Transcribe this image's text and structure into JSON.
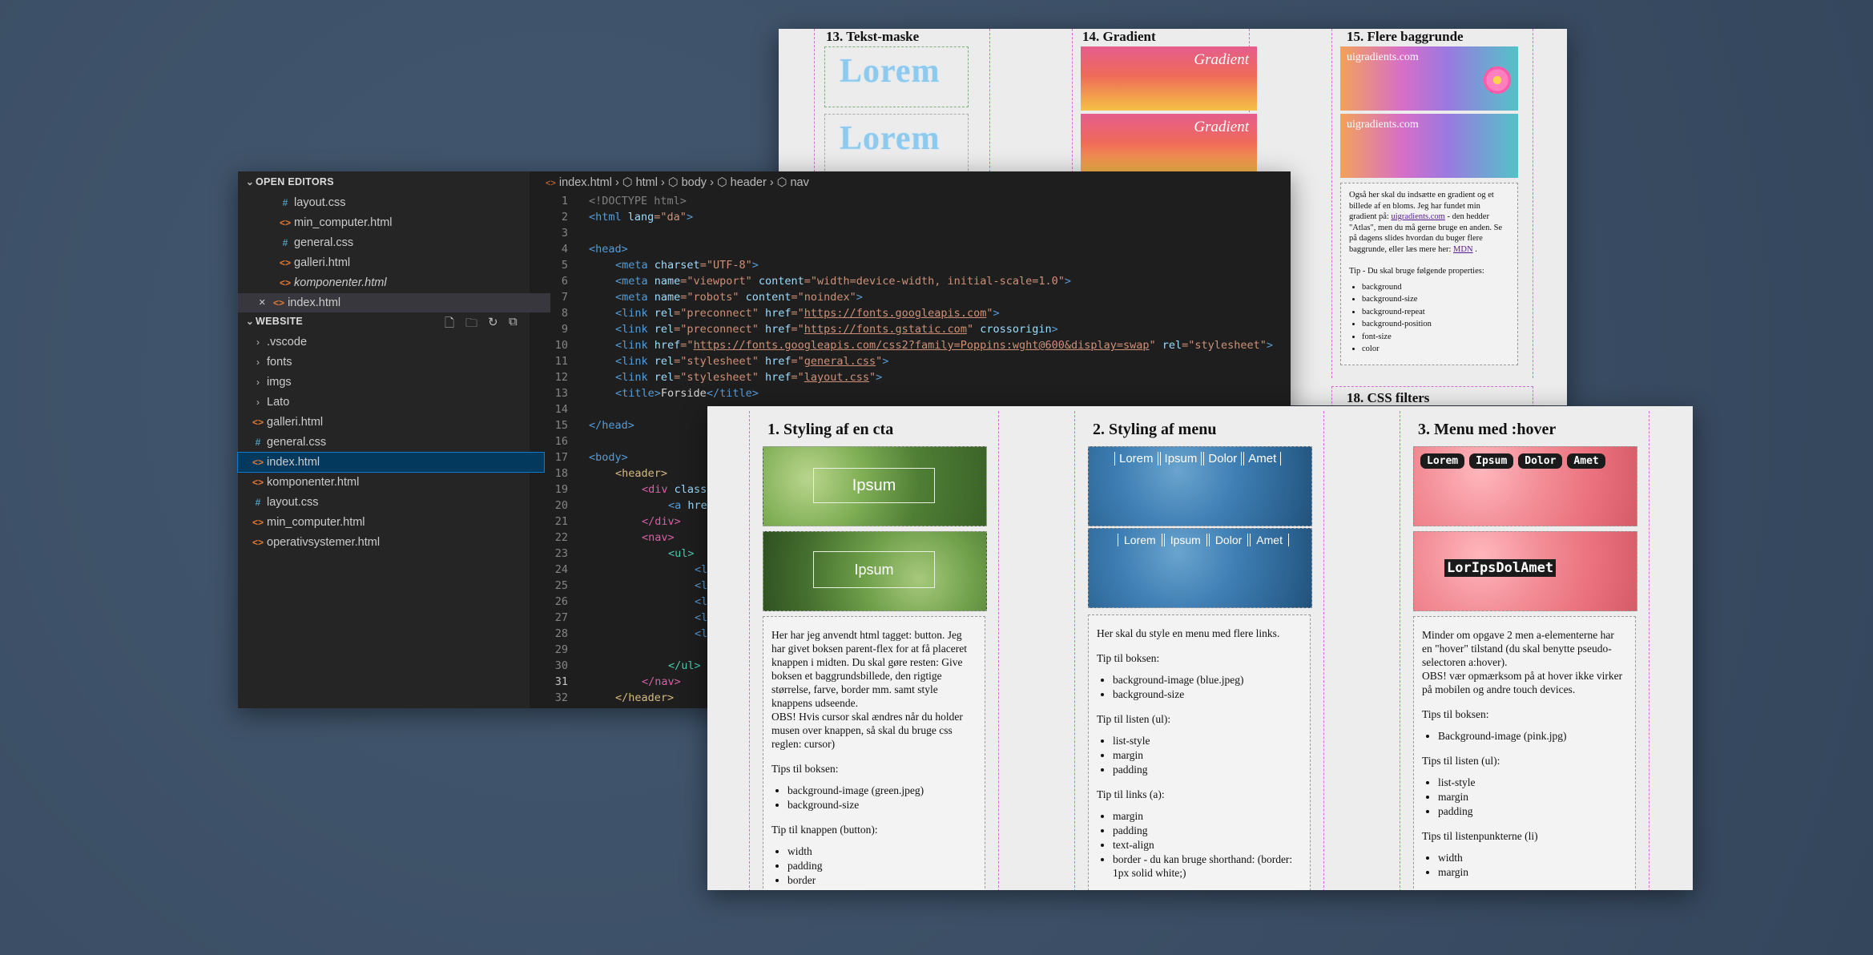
{
  "top_page": {
    "col13": {
      "title": "13. Tekst-maske",
      "text": "Lorem"
    },
    "col14": {
      "title": "14. Gradient",
      "label": "Gradient"
    },
    "col15": {
      "title": "15. Flere baggrunde",
      "label": "uigradients.com",
      "desc_1": "Også her skal du indsætte en gradient og et billede af en bloms. Jeg har fundet min gradient på: ",
      "desc_link": "uigradients.com",
      "desc_2": " - den hedder \"Atlas\", men du må gerne bruge en anden. Se på dagens slides hvordan du buger flere baggrunde, eller læs mere her: ",
      "desc_link2": "MDN",
      "desc_3": " .",
      "tip": "Tip - Du skal bruge følgende properties:",
      "props": [
        "background",
        "background-size",
        "background-repeat",
        "background-position",
        "font-size",
        "color"
      ]
    },
    "col18": {
      "title": "18. CSS filters"
    }
  },
  "editor": {
    "open_editors_label": "OPEN EDITORS",
    "open_editors": [
      {
        "icon": "#",
        "name": "layout.css"
      },
      {
        "icon": "<>",
        "name": "min_computer.html"
      },
      {
        "icon": "#",
        "name": "general.css"
      },
      {
        "icon": "<>",
        "name": "galleri.html"
      },
      {
        "icon": "<>",
        "name": "komponenter.html"
      },
      {
        "icon": "<>",
        "name": "index.html"
      }
    ],
    "close_glyph": "×",
    "website_label": "WEBSITE",
    "folders": [
      ".vscode",
      "fonts",
      "imgs",
      "Lato"
    ],
    "files": [
      {
        "icon": "<>",
        "name": "galleri.html"
      },
      {
        "icon": "#",
        "name": "general.css"
      },
      {
        "icon": "<>",
        "name": "index.html"
      },
      {
        "icon": "<>",
        "name": "komponenter.html"
      },
      {
        "icon": "#",
        "name": "layout.css"
      },
      {
        "icon": "<>",
        "name": "min_computer.html"
      },
      {
        "icon": "<>",
        "name": "operativsystemer.html"
      }
    ],
    "breadcrumb": [
      "index.html",
      "html",
      "body",
      "header",
      "nav"
    ],
    "line_numbers": [
      "1",
      "2",
      "3",
      "4",
      "5",
      "6",
      "7",
      "8",
      "9",
      "10",
      "11",
      "12",
      "13",
      "14",
      "15",
      "16",
      "17",
      "18",
      "19",
      "20",
      "21",
      "22",
      "23",
      "24",
      "25",
      "26",
      "27",
      "28",
      "29",
      "30",
      "31",
      "32"
    ],
    "current_line": "31",
    "code": {
      "l1": "<!DOCTYPE html>",
      "l2a": "<html ",
      "l2b": "lang",
      "l2c": "=\"da\"",
      "l2d": ">",
      "l4": "<head>",
      "l5a": "<meta ",
      "l5b": "charset",
      "l5c": "=\"UTF-8\"",
      "l5d": ">",
      "l6a": "<meta ",
      "l6b": "name",
      "l6c": "=\"viewport\" ",
      "l6e": "content",
      "l6f": "=\"width=device-width, initial-scale=1.0\"",
      "l6g": ">",
      "l7a": "<meta ",
      "l7b": "name",
      "l7c": "=\"robots\" ",
      "l7e": "content",
      "l7f": "=\"noindex\"",
      "l7g": ">",
      "l8a": "<link ",
      "l8b": "rel",
      "l8c": "=\"preconnect\" ",
      "l8e": "href",
      "l8f": "=\"",
      "l8g": "https://fonts.googleapis.com",
      "l8h": "\"",
      "l8i": ">",
      "l9a": "<link ",
      "l9b": "rel",
      "l9c": "=\"preconnect\" ",
      "l9e": "href",
      "l9f": "=\"",
      "l9g": "https://fonts.gstatic.com",
      "l9h": "\" ",
      "l9j": "crossorigin",
      "l9i": ">",
      "l10a": "<link ",
      "l10b": "href",
      "l10c": "=\"",
      "l10d": "https://fonts.googleapis.com/css2?family=Poppins:wght@600&display=swap",
      "l10e": "\" ",
      "l10f": "rel",
      "l10g": "=\"stylesheet\"",
      "l10h": ">",
      "l11a": "<link ",
      "l11b": "rel",
      "l11c": "=\"stylesheet\" ",
      "l11e": "href",
      "l11f": "=\"",
      "l11g": "general.css",
      "l11h": "\"",
      "l11i": ">",
      "l12a": "<link ",
      "l12b": "rel",
      "l12c": "=\"stylesheet\" ",
      "l12e": "href",
      "l12f": "=\"",
      "l12g": "layout.css",
      "l12h": "\"",
      "l12i": ">",
      "l13a": "<title>",
      "l13b": "Forside",
      "l13c": "</title>",
      "l15": "</head>",
      "l17": "<body>",
      "l18": "<header>",
      "l19a": "<div ",
      "l19b": "class",
      "l20a": "<a ",
      "l20b": "hre",
      "l21": "</div>",
      "l22": "<nav>",
      "l23": "<ul>",
      "l24": "<l",
      "l30": "</ul>",
      "l31": "</nav>",
      "l32": "</header>"
    }
  },
  "bottom_page": {
    "col1": {
      "title": "1. Styling af en cta",
      "button": "Ipsum",
      "p1": "Her har jeg anvendt html tagget: button. Jeg har givet boksen parent-flex for at få placeret knappen i midten. Du skal gøre resten: Give boksen et baggrundsbillede, den rigtige størrelse, farve, border mm. samt style knappens udseende.",
      "p1b": "OBS! Hvis cursor skal ændres når du holder musen over knappen, så skal du bruge css reglen: cursor)",
      "h1": "Tips til boksen:",
      "list1": [
        "background-image (green.jpeg)",
        "background-size"
      ],
      "h2": "Tip til knappen (button):",
      "list2": [
        "width",
        "padding",
        "border"
      ]
    },
    "col2": {
      "title": "2. Styling af menu",
      "menu": [
        "Lorem",
        "Ipsum",
        "Dolor",
        "Amet"
      ],
      "p1": "Her skal du style en menu med flere links.",
      "h1": "Tip til boksen:",
      "list1": [
        "background-image (blue.jpeg)",
        "background-size"
      ],
      "h2": "Tip til listen (ul):",
      "list2": [
        "list-style",
        "margin",
        "padding"
      ],
      "h3": "Tip til links (a):",
      "list3": [
        "margin",
        "padding",
        "text-align",
        "border - du kan bruge shorthand: (border: 1px solid white;)"
      ]
    },
    "col3": {
      "title": "3. Menu med :hover",
      "menu": [
        "Lorem",
        "Ipsum",
        "Dolor",
        "Amet"
      ],
      "joined": "LorIpsDolAmet",
      "p1": "Minder om opgave 2 men a-elementerne har en \"hover\" tilstand (du skal benytte pseudo-selectoren a:hover).",
      "p1b": "OBS! vær opmærksom på at hover ikke virker på mobilen og andre touch devices.",
      "h1": "Tips til boksen:",
      "list1": [
        "Background-image (pink.jpg)"
      ],
      "h2": "Tips til listen (ul):",
      "list2": [
        "list-style",
        "margin",
        "padding"
      ],
      "h3": "Tips til listenpunkterne (li)",
      "list3": [
        "width",
        "margin"
      ]
    }
  }
}
